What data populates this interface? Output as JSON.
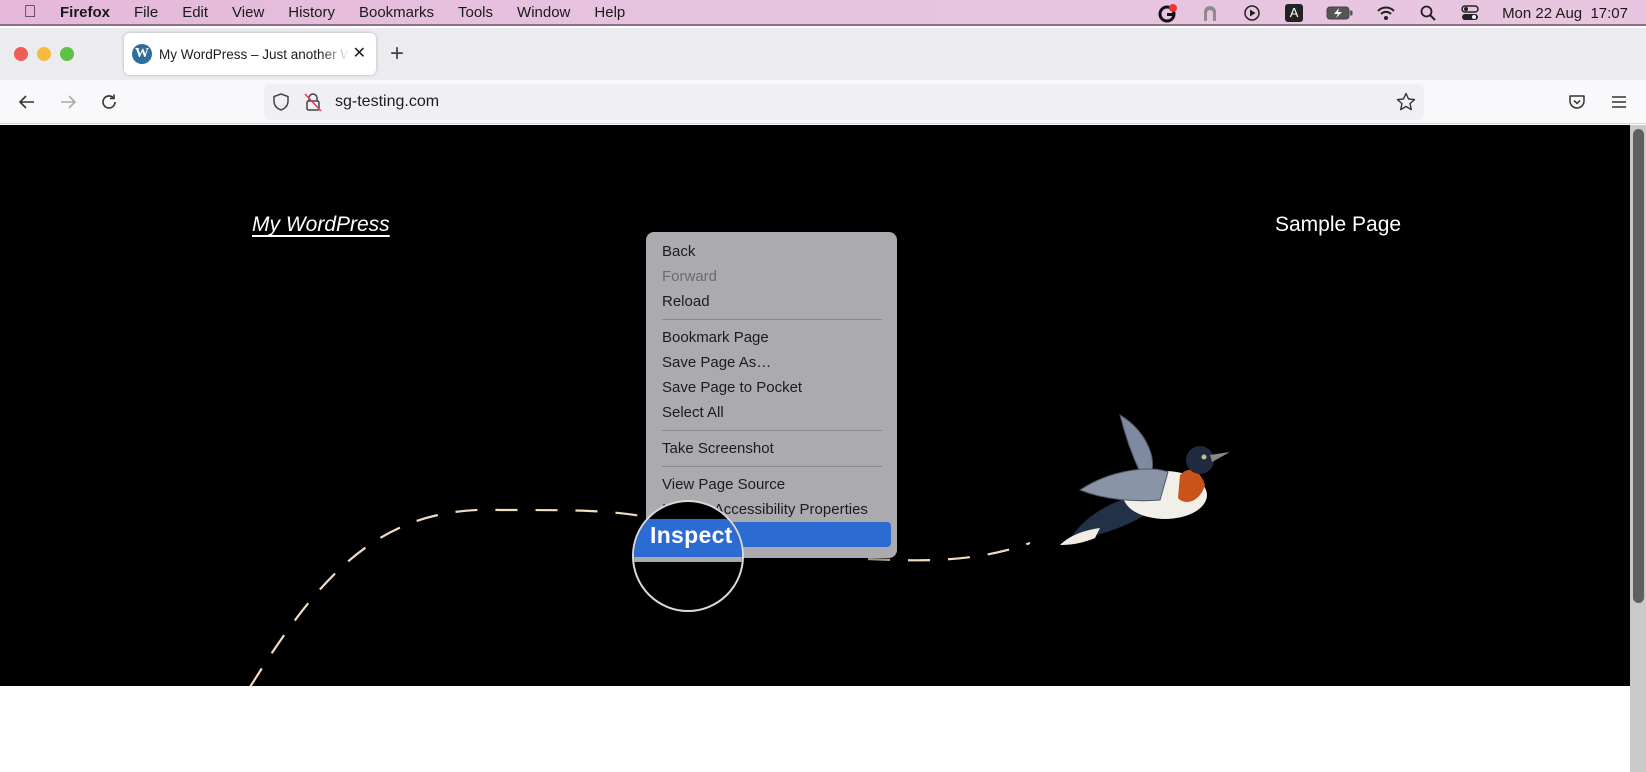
{
  "menubar": {
    "app_name": "Firefox",
    "items": [
      "File",
      "Edit",
      "View",
      "History",
      "Bookmarks",
      "Tools",
      "Window",
      "Help"
    ],
    "status_icons": [
      "grammarly-icon",
      "arch-icon",
      "play-icon",
      "keyboard-a-icon",
      "battery-charging-icon",
      "wifi-icon",
      "spotlight-search-icon",
      "control-center-icon"
    ],
    "keyboard_letter": "A",
    "clock": "Mon 22 Aug  17:07"
  },
  "browser": {
    "tab": {
      "title": "My WordPress – Just another WordPress site",
      "favicon": "W"
    },
    "url": "sg-testing.com"
  },
  "page": {
    "site_title": "My WordPress",
    "nav_link": "Sample Page"
  },
  "context_menu": {
    "groups": [
      [
        {
          "label": "Back",
          "enabled": true
        },
        {
          "label": "Forward",
          "enabled": false
        },
        {
          "label": "Reload",
          "enabled": true
        }
      ],
      [
        {
          "label": "Bookmark Page",
          "enabled": true
        },
        {
          "label": "Save Page As…",
          "enabled": true
        },
        {
          "label": "Save Page to Pocket",
          "enabled": true
        },
        {
          "label": "Select All",
          "enabled": true
        }
      ],
      [
        {
          "label": "Take Screenshot",
          "enabled": true
        }
      ],
      [
        {
          "label": "View Page Source",
          "enabled": true
        },
        {
          "label": "Inspect Accessibility Properties",
          "enabled": true
        },
        {
          "label": "Inspect",
          "enabled": true,
          "highlighted": true
        }
      ]
    ],
    "magnified_label": "Inspect"
  },
  "colors": {
    "menu_highlight": "#2c6bd1",
    "menu_bg": "#ababaf",
    "dash_line": "#f2dcc0"
  }
}
